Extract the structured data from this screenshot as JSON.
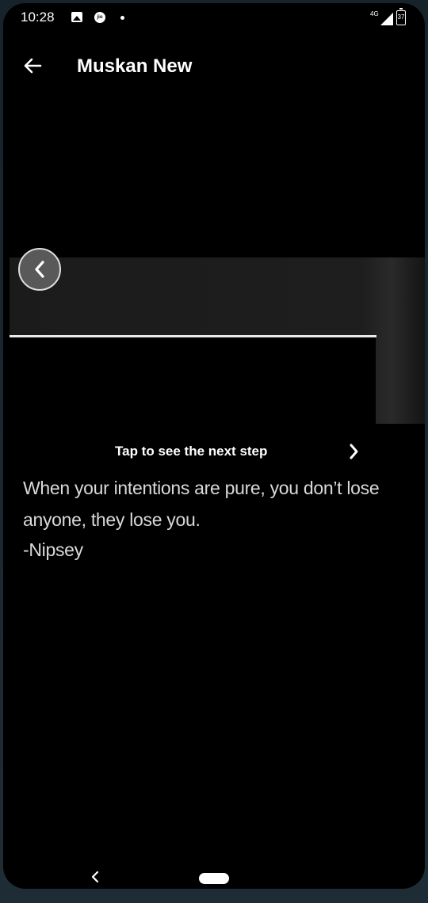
{
  "status_bar": {
    "time": "10:28",
    "network": "4G",
    "battery": "37",
    "icons": [
      "gallery-icon",
      "jio-icon",
      "notification-dot-icon",
      "signal-icon",
      "battery-icon"
    ]
  },
  "app_bar": {
    "back_icon": "arrow-left-icon",
    "title": "Muskan New"
  },
  "story": {
    "prev_icon": "chevron-left-icon",
    "tap_hint": "Tap to see the next step",
    "next_icon": "chevron-right-icon",
    "quote": "When your intentions are pure, you don’t lose anyone, they lose you.",
    "author": "-Nipsey"
  },
  "nav_bar": {
    "back_icon": "nav-back-icon",
    "home_icon": "home-pill-icon"
  }
}
